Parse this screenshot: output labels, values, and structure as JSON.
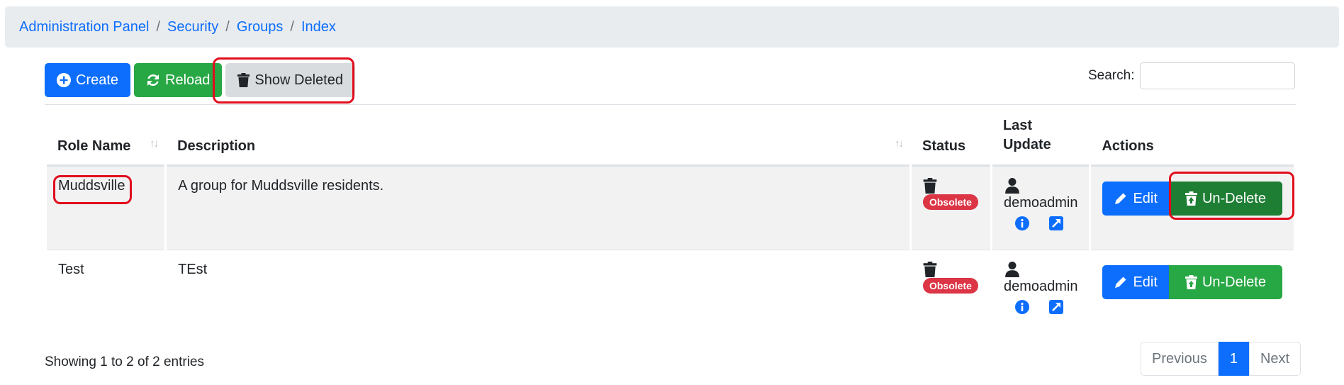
{
  "breadcrumb": [
    "Administration Panel",
    "Security",
    "Groups",
    "Index"
  ],
  "toolbar": {
    "create_label": "Create",
    "reload_label": "Reload",
    "show_deleted_label": "Show Deleted"
  },
  "search": {
    "label": "Search:",
    "value": ""
  },
  "table": {
    "headers": [
      "Role Name",
      "Description",
      "Status",
      "Last Update",
      "Actions"
    ],
    "rows": [
      {
        "role_name": "Muddsville",
        "description": "A group for Muddsville residents.",
        "status": "Obsolete",
        "updated_by": "demoadmin",
        "edit_label": "Edit",
        "undelete_label": "Un-Delete"
      },
      {
        "role_name": "Test",
        "description": "TEst",
        "status": "Obsolete",
        "updated_by": "demoadmin",
        "edit_label": "Edit",
        "undelete_label": "Un-Delete"
      }
    ]
  },
  "footer": {
    "info": "Showing 1 to 2 of 2 entries",
    "previous_label": "Previous",
    "current_page": "1",
    "next_label": "Next"
  },
  "colors": {
    "primary": "#0d6efd",
    "success": "#28a745",
    "danger": "#dc3545",
    "highlight": "#e10d1d"
  }
}
